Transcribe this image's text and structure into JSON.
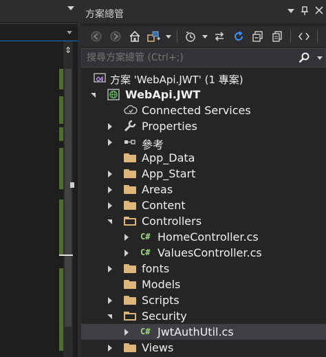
{
  "panel": {
    "title": "方案總管"
  },
  "search": {
    "placeholder": "搜尋方案總管 (Ctrl+;)"
  },
  "toolbar": {
    "icons": [
      "back-icon",
      "forward-icon",
      "home-icon",
      "switch-views-icon",
      "pending-changes-filter-icon",
      "sync-icon",
      "refresh-icon",
      "collapse-all-icon",
      "copy-icon",
      "code-view-icon"
    ]
  },
  "tree": {
    "solution": "方案 'WebApi.JWT' (1 專案)",
    "project": "WebApi.JWT",
    "items": [
      {
        "label": "Connected Services"
      },
      {
        "label": "Properties"
      },
      {
        "label": "參考"
      },
      {
        "label": "App_Data"
      },
      {
        "label": "App_Start"
      },
      {
        "label": "Areas"
      },
      {
        "label": "Content"
      },
      {
        "label": "Controllers"
      },
      {
        "label": "HomeController.cs"
      },
      {
        "label": "ValuesController.cs"
      },
      {
        "label": "fonts"
      },
      {
        "label": "Models"
      },
      {
        "label": "Scripts"
      },
      {
        "label": "Security"
      },
      {
        "label": "JwtAuthUtil.cs"
      },
      {
        "label": "Views"
      }
    ],
    "cs_badge": "C#"
  },
  "colors": {
    "folder": "#dcb67a",
    "csharp": "#9cd67e",
    "accent": "#007acc",
    "selection": "#3f3f46"
  }
}
